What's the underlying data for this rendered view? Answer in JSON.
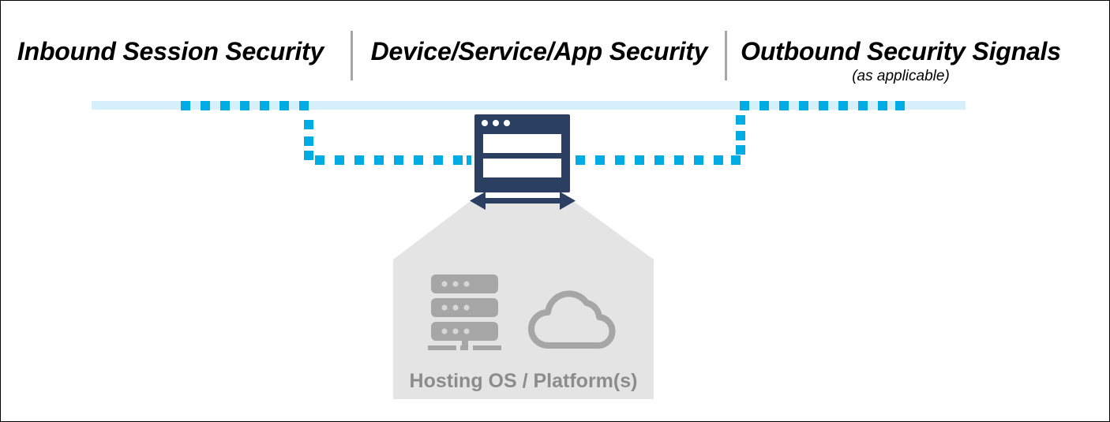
{
  "diagram": {
    "title": "Security layers across inbound session, device/service/app, and outbound signals",
    "colors": {
      "pale_band": "#d6f0fb",
      "dash_blue": "#00ace3",
      "navy": "#2b3f63",
      "host_gray": "#e4e4e4",
      "icon_gray": "#a6a6a6",
      "label_gray": "#8c8c8c",
      "divider_gray": "#a6a6a6",
      "border": "#000000"
    }
  },
  "headings": {
    "inbound": "Inbound Session Security",
    "device": "Device/Service/App Security",
    "outbound": "Outbound Security Signals",
    "outbound_sub": "(as applicable)"
  },
  "center": {
    "icon": "browser-window-icon",
    "titlebar_dots": 3,
    "panes": 2,
    "arrow": "bidirectional-arrow"
  },
  "host": {
    "label": "Hosting OS / Platform(s)",
    "icons": [
      "server-stack-icon",
      "cloud-icon"
    ]
  },
  "flow": {
    "band_label": "security-signal-band",
    "dashed_path_label": "dashed-session-path",
    "left_segment": "inbound-dashed-segment",
    "middle_segment": "device-dashed-segment",
    "right_segment": "outbound-dashed-segment"
  }
}
